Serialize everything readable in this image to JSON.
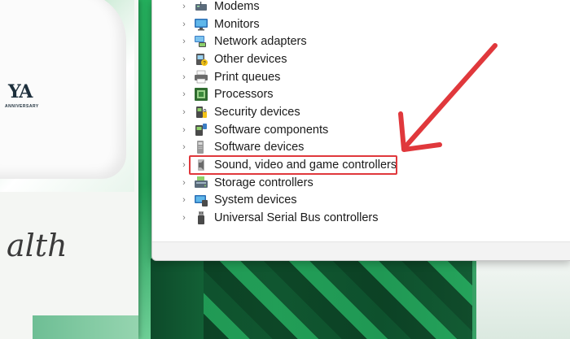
{
  "device_tree": {
    "items": [
      {
        "label": "Modems",
        "icon": "modem-icon"
      },
      {
        "label": "Monitors",
        "icon": "monitor-icon"
      },
      {
        "label": "Network adapters",
        "icon": "network-adapter-icon"
      },
      {
        "label": "Other devices",
        "icon": "unknown-device-icon"
      },
      {
        "label": "Print queues",
        "icon": "printer-icon"
      },
      {
        "label": "Processors",
        "icon": "processor-icon"
      },
      {
        "label": "Security devices",
        "icon": "security-device-icon"
      },
      {
        "label": "Software components",
        "icon": "software-component-icon"
      },
      {
        "label": "Software devices",
        "icon": "software-device-icon"
      },
      {
        "label": "Sound, video and game controllers",
        "icon": "speaker-icon",
        "highlighted": true
      },
      {
        "label": "Storage controllers",
        "icon": "storage-controller-icon"
      },
      {
        "label": "System devices",
        "icon": "system-device-icon"
      },
      {
        "label": "Universal Serial Bus controllers",
        "icon": "usb-icon"
      }
    ]
  },
  "annotation": {
    "color": "#e0383c",
    "arrow_icon": "arrow-pointer-icon"
  },
  "background": {
    "script_text": "alth",
    "logo_text": "YA",
    "logo_subtext": "ANNIVERSARY"
  }
}
